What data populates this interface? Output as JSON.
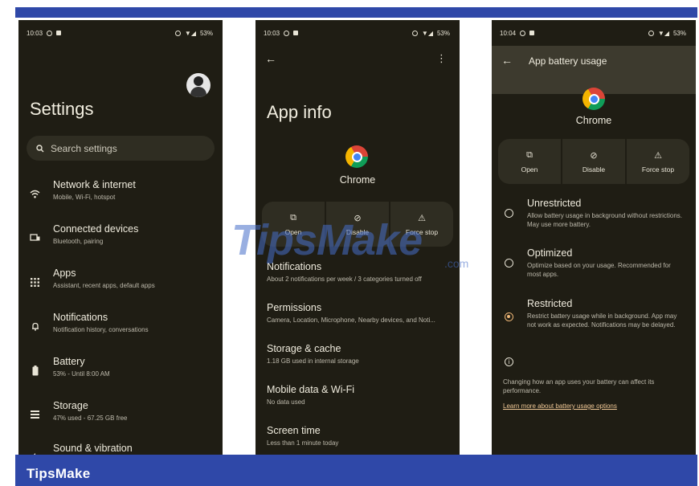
{
  "brand": "TipsMake",
  "watermark": {
    "text": "TipsMake",
    "suffix": ".com"
  },
  "screen1": {
    "status": {
      "time": "10:03",
      "battery": "53%"
    },
    "title": "Settings",
    "search_placeholder": "Search settings",
    "items": [
      {
        "title": "Network & internet",
        "desc": "Mobile, Wi-Fi, hotspot",
        "icon": "wifi-icon"
      },
      {
        "title": "Connected devices",
        "desc": "Bluetooth, pairing",
        "icon": "connected-devices-icon"
      },
      {
        "title": "Apps",
        "desc": "Assistant, recent apps, default apps",
        "icon": "apps-grid-icon"
      },
      {
        "title": "Notifications",
        "desc": "Notification history, conversations",
        "icon": "bell-icon"
      },
      {
        "title": "Battery",
        "desc": "53% - Until 8:00 AM",
        "icon": "battery-icon"
      },
      {
        "title": "Storage",
        "desc": "47% used - 67.25 GB free",
        "icon": "storage-icon"
      },
      {
        "title": "Sound & vibration",
        "desc": "",
        "icon": "sound-icon"
      }
    ]
  },
  "screen2": {
    "status": {
      "time": "10:03",
      "battery": "53%"
    },
    "title": "App info",
    "app_name": "Chrome",
    "actions": [
      {
        "label": "Open",
        "icon": "open-icon"
      },
      {
        "label": "Disable",
        "icon": "disable-icon"
      },
      {
        "label": "Force stop",
        "icon": "warning-icon"
      }
    ],
    "items": [
      {
        "title": "Notifications",
        "desc": "About 2 notifications per week / 3 categories turned off"
      },
      {
        "title": "Permissions",
        "desc": "Camera, Location, Microphone, Nearby devices, and Noti..."
      },
      {
        "title": "Storage & cache",
        "desc": "1.18 GB used in internal storage"
      },
      {
        "title": "Mobile data & Wi-Fi",
        "desc": "No data used"
      },
      {
        "title": "Screen time",
        "desc": "Less than 1 minute today"
      }
    ]
  },
  "screen3": {
    "status": {
      "time": "10:04",
      "battery": "53%"
    },
    "title": "App battery usage",
    "app_name": "Chrome",
    "actions": [
      {
        "label": "Open",
        "icon": "open-icon"
      },
      {
        "label": "Disable",
        "icon": "disable-icon"
      },
      {
        "label": "Force stop",
        "icon": "warning-icon"
      }
    ],
    "options": [
      {
        "title": "Unrestricted",
        "desc": "Allow battery usage in background without restrictions. May use more battery.",
        "selected": false
      },
      {
        "title": "Optimized",
        "desc": "Optimize based on your usage. Recommended for most apps.",
        "selected": false
      },
      {
        "title": "Restricted",
        "desc": "Restrict battery usage while in background. App may not work as expected. Notifications may be delayed.",
        "selected": true
      }
    ],
    "note": "Changing how an app uses your battery can affect its performance.",
    "link": "Learn more about battery usage options"
  }
}
